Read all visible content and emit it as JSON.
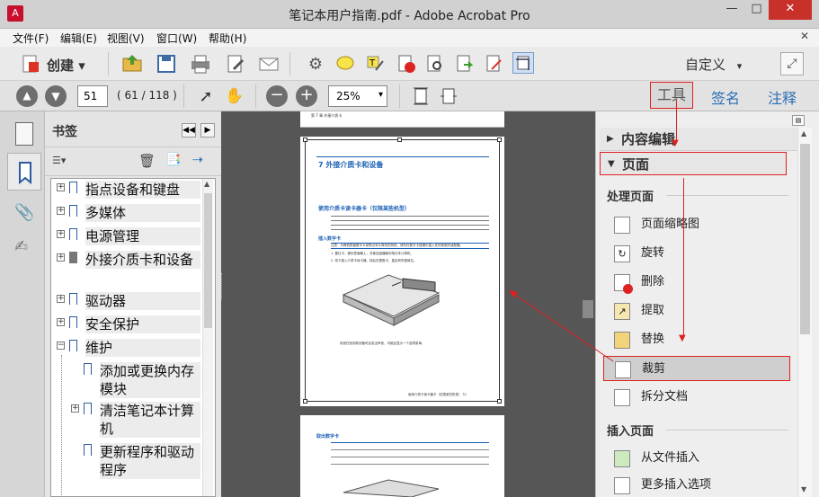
{
  "window": {
    "title": "笔记本用户指南.pdf - Adobe Acrobat Pro",
    "minimize": "—",
    "maximize": "□",
    "close": "✕"
  },
  "menu": [
    "文件(F)",
    "编辑(E)",
    "视图(V)",
    "窗口(W)",
    "帮助(H)"
  ],
  "toolbar": {
    "create_label": "创建",
    "customize_label": "自定义"
  },
  "nav": {
    "page_number": "51",
    "page_count": "( 61 / 118 )",
    "zoom": "25%"
  },
  "tabs": {
    "tools": "工具",
    "sign": "签名",
    "comment": "注释"
  },
  "bookmarks": {
    "title": "书签",
    "items": [
      {
        "label": "指点设备和键盘"
      },
      {
        "label": "多媒体"
      },
      {
        "label": "电源管理"
      },
      {
        "label": "外接介质卡和设备"
      },
      {
        "label": "驱动器"
      },
      {
        "label": "安全保护"
      },
      {
        "label": "维护"
      },
      {
        "label": "添加或更换内存模块"
      },
      {
        "label": "清洁笔记本计算机"
      },
      {
        "label": "更新程序和驱动程序"
      }
    ]
  },
  "document": {
    "page_header": "第 7 章  外接介质卡",
    "chapter_title": "7    外接介质卡和设备",
    "section_title": "使用介质卡读卡器卡（仅限某些机型）",
    "subsection_insert": "插入数字卡",
    "caution": "注意：为降低损害数字卡或笔记本计算机的风险，请勿在数字卡插槽中插入任何类型的适配器。",
    "step1": "1.  握住卡，使标签面朝上，并使连接器朝向笔记本计算机。",
    "step2": "2.  将卡插入介质卡读卡器，然后向里推卡，直至其牢固就位。",
    "figure_caption": "系统在检测到设备时会发出声音，可能会显示一个选项菜单。",
    "footer": "使用介质卡读卡器卡（仅限某些机型）  51",
    "next_subsection": "取出数字卡"
  },
  "right_panel": {
    "content_edit": "内容编辑",
    "pages": "页面",
    "process_pages": "处理页面",
    "items": [
      "页面缩略图",
      "旋转",
      "删除",
      "提取",
      "替换",
      "裁剪",
      "拆分文档"
    ],
    "insert_pages": "插入页面",
    "insert_items": [
      "从文件插入",
      "更多插入选项"
    ]
  },
  "colors": {
    "annotation": "#e02020",
    "doc_bg": "#565656",
    "link_blue": "#1a5fb4"
  }
}
